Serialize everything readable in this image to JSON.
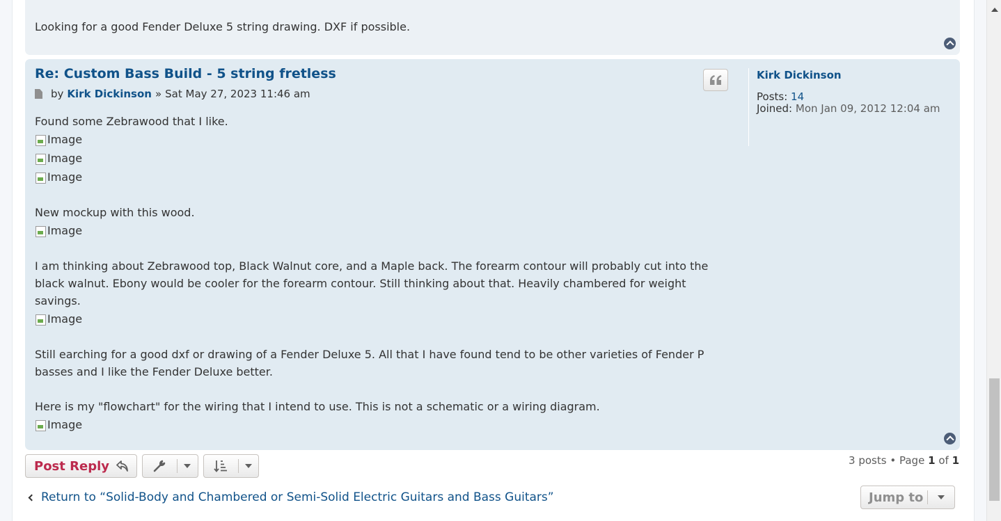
{
  "previous_post": {
    "text": "Looking for a good Fender Deluxe 5 string drawing. DXF if possible."
  },
  "post": {
    "title": "Re: Custom Bass Build - 5 string fretless",
    "by_label": "by",
    "author": "Kirk Dickinson",
    "date_sep": "»",
    "date": "Sat May 27, 2023 11:46 am",
    "quote_icon": "quote-icon",
    "body": {
      "line1": "Found some Zebrawood that I like.",
      "image_alt": "Image",
      "line2": "New mockup with this wood.",
      "para3": "I am thinking about Zebrawood top, Black Walnut core, and a Maple back. The forearm contour will probably cut into the black walnut. Ebony would be cooler for the forearm contour. Still thinking about that. Heavily chambered for weight savings.",
      "para4": "Still earching for a good dxf or drawing of a Fender Deluxe 5. All that I have found tend to be other varieties of Fender P basses and I like the Fender Deluxe better.",
      "para5": "Here is my \"flowchart\" for the wiring that I intend to use. This is not a schematic or a wiring diagram."
    }
  },
  "profile": {
    "username": "Kirk Dickinson",
    "posts_label": "Posts:",
    "posts_value": "14",
    "joined_label": "Joined:",
    "joined_value": "Mon Jan 09, 2012 12:04 am"
  },
  "actions": {
    "post_reply": "Post Reply",
    "pagination": {
      "count": "3 posts",
      "bullet": "•",
      "page_label": "Page",
      "current": "1",
      "of_label": "of",
      "total": "1"
    },
    "return_link": "Return to “Solid-Body and Chambered or Semi-Solid Electric Guitars and Bass Guitars”",
    "jump_to": "Jump to"
  },
  "colors": {
    "accent": "#105289",
    "post_reply": "#bc2a4d",
    "post_bg": "#e1ebf2",
    "prev_post_bg": "#ecf1f5"
  }
}
